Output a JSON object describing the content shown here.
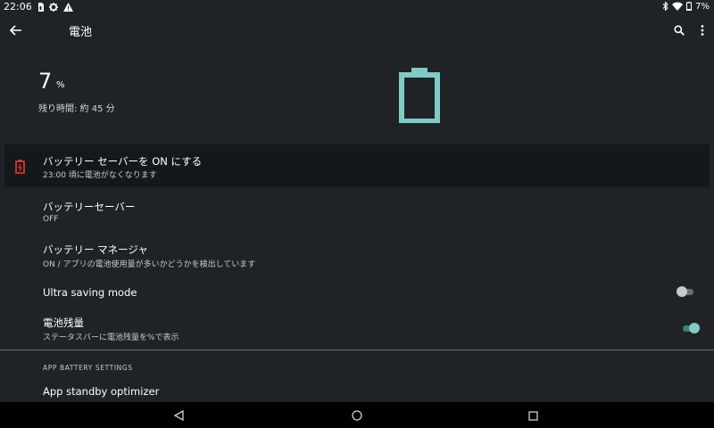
{
  "status_bar": {
    "time": "22:06",
    "battery_percent": "7%",
    "left_icons": [
      "sim-card-icon",
      "gear-icon",
      "warning-icon"
    ],
    "right_icons": [
      "bluetooth-icon",
      "wifi-icon",
      "battery-icon"
    ]
  },
  "app_bar": {
    "title": "電池",
    "back_icon": "arrow-back-icon",
    "search_icon": "search-icon",
    "more_icon": "more-vert-icon"
  },
  "header": {
    "percent_value": "7",
    "percent_unit": "%",
    "remaining_text": "残り時間: 約 45 分",
    "battery_color": "#80cbc4",
    "battery_level": 0.07
  },
  "battery_saver_suggestion": {
    "title": "バッテリー セーバーを ON にする",
    "subtitle": "23:00 頃に電池がなくなります",
    "icon": "battery-alert-icon",
    "icon_color": "#e53935"
  },
  "settings": {
    "battery_saver": {
      "title": "バッテリーセーバー",
      "subtitle": "OFF"
    },
    "battery_manager": {
      "title": "バッテリー マネージャ",
      "subtitle": "ON / アプリの電池使用量が多いかどうかを検出しています"
    },
    "ultra_saving": {
      "title": "Ultra saving mode",
      "enabled": false
    },
    "battery_percentage": {
      "title": "電池残量",
      "subtitle": "ステータスバーに電池残量を%で表示",
      "enabled": true
    }
  },
  "app_battery_section": {
    "header": "APP BATTERY SETTINGS",
    "items": [
      {
        "title": "App standby optimizer"
      }
    ]
  },
  "nav_bar": {
    "back_icon": "nav-back-icon",
    "home_icon": "nav-home-icon",
    "recents_icon": "nav-recents-icon"
  },
  "colors": {
    "background": "#1f2326",
    "accent": "#80cbc4",
    "alert": "#e53935"
  }
}
